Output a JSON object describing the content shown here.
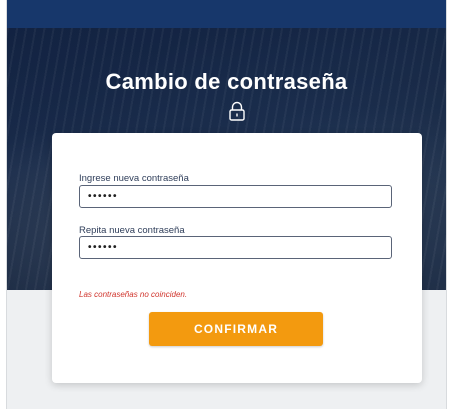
{
  "page": {
    "title": "Cambio de contraseña",
    "lock_icon": "lock-icon"
  },
  "form": {
    "new_password_label": "Ingrese nueva contraseña",
    "new_password_value": "••••••",
    "repeat_password_label": "Repita nueva contraseña",
    "repeat_password_value": "••••••",
    "error_message": "Las contraseñas no coinciden.",
    "confirm_label": "CONFIRMAR"
  },
  "colors": {
    "topbar": "#17376b",
    "button": "#f39a0f",
    "error": "#d0342c"
  }
}
